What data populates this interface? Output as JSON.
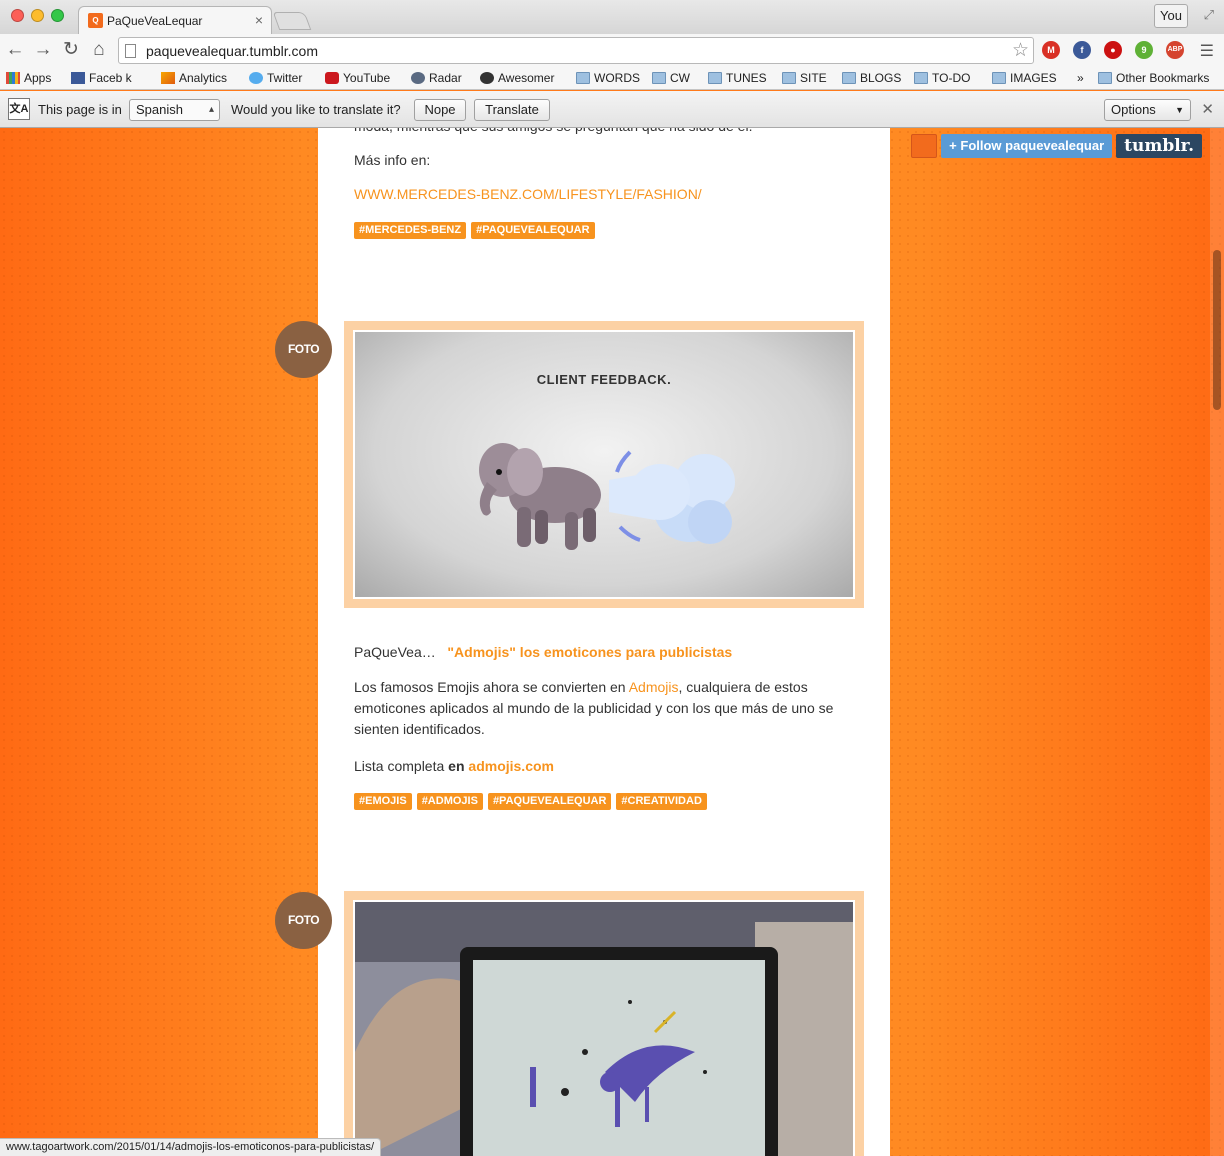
{
  "browser": {
    "tab_title": "PaQueVeaLequar",
    "tab_close": "×",
    "user": "You",
    "url": "paquevealequar.tumblr.com",
    "nav": {
      "back": "←",
      "forward": "→",
      "reload": "↻",
      "home": "⌂"
    },
    "extensions": [
      {
        "name": "gmail-icon",
        "color": "#d93025",
        "glyph": "M"
      },
      {
        "name": "facebook-icon",
        "color": "#3b5998",
        "glyph": "f"
      },
      {
        "name": "stop-icon",
        "color": "#cc1111",
        "glyph": "●"
      },
      {
        "name": "evernote-icon",
        "color": "#5fb136",
        "glyph": "9"
      },
      {
        "name": "adblock-icon",
        "color": "#d5442f",
        "glyph": "ABP"
      }
    ]
  },
  "bookmarks": {
    "apps": "Apps",
    "facebook": "Faceb  k",
    "analytics": "Analytics",
    "twitter": "Twitter",
    "youtube": "YouTube",
    "radar": "Radar",
    "awesomer": "Awesomer",
    "words": "WORDS",
    "cw": "CW",
    "tunes": "TUNES",
    "site": "SITE",
    "blogs": "BLOGS",
    "todo": "TO-DO",
    "images": "IMAGES",
    "more": "»",
    "other": "Other Bookmarks"
  },
  "translate": {
    "icon": "文A",
    "prefix": "This page is in",
    "language": "Spanish",
    "question": "Would you like to translate it?",
    "nope": "Nope",
    "translate": "Translate",
    "options": "Options"
  },
  "tumblr": {
    "follow": "+ Follow paquevealequar",
    "logo": "tumblr."
  },
  "post1": {
    "cut_text": "moda, mientras que sus amigos se preguntan que ha sido de él.",
    "more_info": "Más info en:",
    "link": "WWW.MERCEDES-BENZ.COM/LIFESTYLE/FASHION/",
    "tags": [
      "#MERCEDES-BENZ",
      "#PAQUEVEALEQUAR"
    ]
  },
  "post2": {
    "badge": "FOTO",
    "image_caption": "CLIENT FEEDBACK.",
    "title_prefix": "PaQueVea…",
    "title": "\"Admojis\" los emoticones para publicistas",
    "body_1": "Los famosos Emojis ahora se convierten en",
    "body_link": "Admojis",
    "body_2": ",  cualquiera de estos emoticones aplicados al mundo de la publicidad y  con los que más de uno se sienten identificados.",
    "list_label": "Lista completa",
    "list_en": "en",
    "list_link": "admojis.com",
    "tags": [
      "#EMOJIS",
      "#ADMOJIS",
      "#PAQUEVEALEQUAR",
      "#CREATIVIDAD"
    ]
  },
  "post3": {
    "badge": "FOTO"
  },
  "status_url": "www.tagoartwork.com/2015/01/14/admojis-los-emoticonos-para-publicistas/",
  "colors": {
    "accent": "#f7931e",
    "background": "#ff7a1a",
    "badge": "#8a6142",
    "frame": "#fcd1a4"
  }
}
